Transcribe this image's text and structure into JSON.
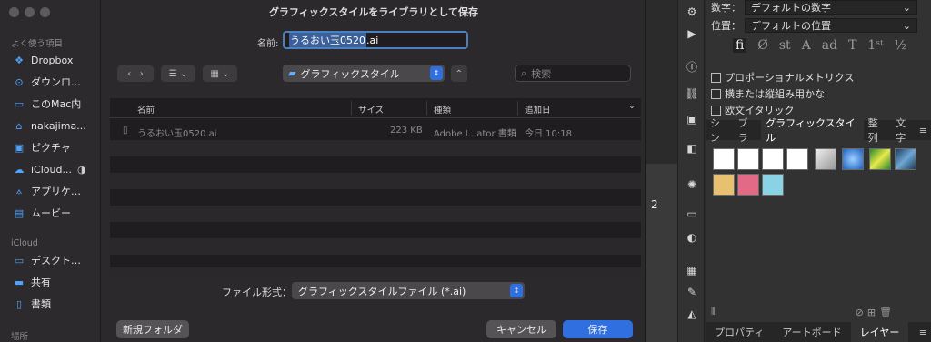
{
  "sidebar": {
    "section_favorites": "よく使う項目",
    "section_icloud": "iCloud",
    "section_places": "場所",
    "items": [
      {
        "label": "Dropbox",
        "icon": "dropbox-icon"
      },
      {
        "label": "ダウンロ…",
        "icon": "download-icon"
      },
      {
        "label": "このMac内",
        "icon": "folder-icon"
      },
      {
        "label": "nakajima...",
        "icon": "home-icon"
      },
      {
        "label": "ピクチャ",
        "icon": "picture-icon"
      },
      {
        "label": "iCloud...",
        "icon": "cloud-icon"
      },
      {
        "label": "アプリケ…",
        "icon": "apps-icon"
      },
      {
        "label": "ムービー",
        "icon": "movie-icon"
      }
    ],
    "icloud_items": [
      {
        "label": "デスクト…",
        "icon": "desktop-icon"
      },
      {
        "label": "共有",
        "icon": "shared-folder-icon"
      },
      {
        "label": "書類",
        "icon": "document-icon"
      }
    ]
  },
  "dialog": {
    "title": "グラフィックスタイルをライブラリとして保存",
    "name_label": "名前:",
    "filename_selected": "うるおい玉0520",
    "filename_ext": ".ai",
    "location": "グラフィックスタイル",
    "search_placeholder": "検索",
    "columns": {
      "name": "名前",
      "size": "サイズ",
      "kind": "種類",
      "date": "追加日"
    },
    "files": [
      {
        "name": "うるおい玉0520.ai",
        "size": "223 KB",
        "kind": "Adobe I...ator 書類",
        "date": "今日 10:18"
      }
    ],
    "format_label": "ファイル形式：",
    "format_value": "グラフィックスタイルファイル (*.ai)",
    "new_folder": "新規フォルダ",
    "cancel": "キャンセル",
    "save": "保存"
  },
  "illustrator": {
    "number_label": "数字：",
    "number_value": "デフォルトの数字",
    "position_label": "位置：",
    "position_value": "デフォルトの位置",
    "checkboxes": [
      "プロポーショナルメトリクス",
      "横または縦組み用かな",
      "欧文イタリック"
    ],
    "style_tabs": [
      "シン",
      "ブラ",
      "グラフィックスタイル",
      "整列",
      "文字"
    ],
    "bottom_tabs": [
      "プロパティ",
      "アートボード",
      "レイヤー"
    ],
    "canvas_number": "2",
    "accent": "#2f6fe0"
  }
}
